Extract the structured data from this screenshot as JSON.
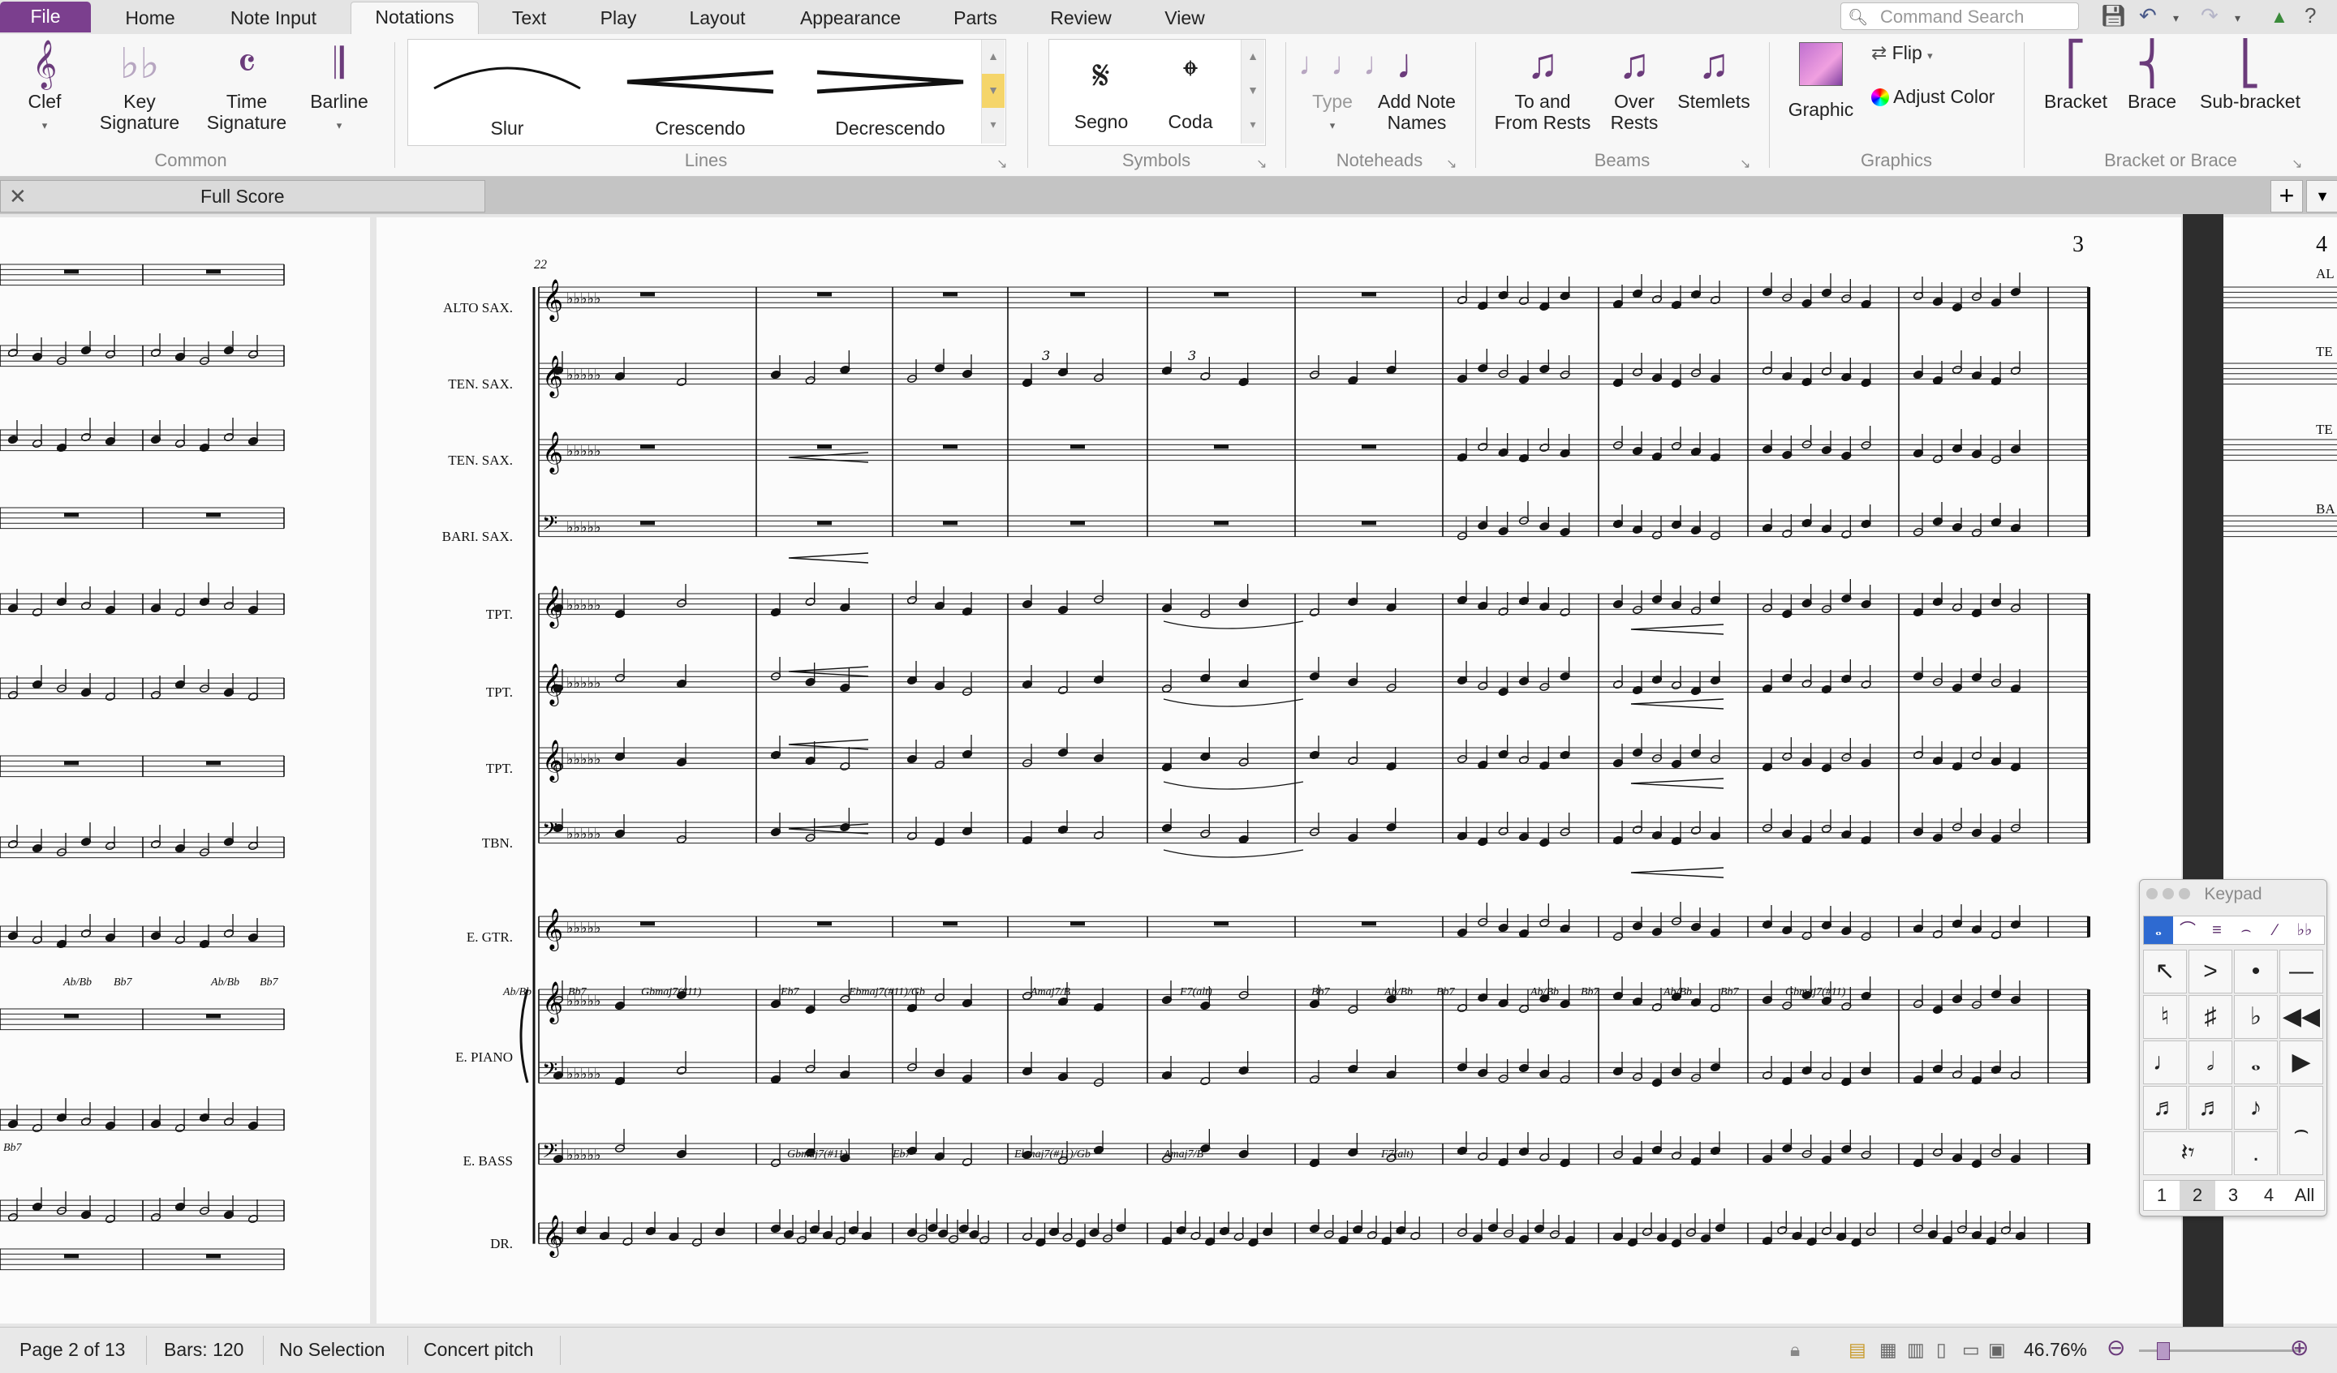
{
  "tabs": [
    {
      "label": "File"
    },
    {
      "label": "Home"
    },
    {
      "label": "Note Input"
    },
    {
      "label": "Notations"
    },
    {
      "label": "Text"
    },
    {
      "label": "Play"
    },
    {
      "label": "Layout"
    },
    {
      "label": "Appearance"
    },
    {
      "label": "Parts"
    },
    {
      "label": "Review"
    },
    {
      "label": "View"
    }
  ],
  "active_tab": "Notations",
  "command_search": {
    "placeholder": "Command Search"
  },
  "ribbon": {
    "common": {
      "label": "Common",
      "clef": "Clef",
      "key_signature": "Key\nSignature",
      "time_signature": "Time\nSignature",
      "barline": "Barline"
    },
    "lines": {
      "label": "Lines",
      "items": [
        "Slur",
        "Crescendo",
        "Decrescendo"
      ]
    },
    "symbols": {
      "label": "Symbols",
      "items": [
        "Segno",
        "Coda"
      ]
    },
    "noteheads": {
      "label": "Noteheads",
      "type": "Type",
      "add_note_names": "Add Note\nNames"
    },
    "beams": {
      "label": "Beams",
      "to_from_rests": "To and\nFrom Rests",
      "over_rests": "Over\nRests",
      "stemlets": "Stemlets"
    },
    "graphics": {
      "label": "Graphics",
      "graphic": "Graphic",
      "flip": "Flip",
      "adjust_color": "Adjust Color"
    },
    "bracket": {
      "label": "Bracket or Brace",
      "bracket": "Bracket",
      "brace": "Brace",
      "sub_bracket": "Sub-bracket"
    }
  },
  "document_tab": {
    "label": "Full Score"
  },
  "score": {
    "page_number": "3",
    "next_page_number": "4",
    "start_bar": "22",
    "instruments": [
      "ALTO SAX.",
      "TEN. SAX.",
      "TEN. SAX.",
      "BARI. SAX.",
      "TPT.",
      "TPT.",
      "TPT.",
      "TBN.",
      "E. GTR.",
      "E. PIANO",
      "E. BASS",
      "DR."
    ],
    "next_page_instruments": [
      "AL",
      "TE",
      "TE",
      "BA"
    ],
    "piano_chords": [
      "Ab/Bb",
      "Bb7",
      "Gbmaj7(#11)",
      "Eb7",
      "Ebmaj7(#11)/Gb",
      "Amaj7/B",
      "F7(alt)",
      "Bb7",
      "Ab/Bb",
      "Bb7",
      "Ab/Bb",
      "Bb7",
      "Ab/Bb",
      "Bb7",
      "Gbmaj7(#11)"
    ],
    "bass_chords": [
      "Gbmaj7(#11)",
      "Eb7",
      "Ebmaj7(#11)/Gb",
      "Amaj7/B",
      "F7(alt)"
    ],
    "left_chords": [
      "Ab/Bb",
      "Bb7",
      "Ab/Bb",
      "Bb7",
      "Bb7"
    ],
    "tuplet": "3"
  },
  "keypad": {
    "title": "Keypad",
    "tabs": [
      "1",
      "2",
      "3",
      "4",
      "All"
    ],
    "selected_tab": "2"
  },
  "status": {
    "page": "Page 2 of 13",
    "bars": "Bars: 120",
    "selection": "No Selection",
    "pitch": "Concert pitch",
    "zoom": "46.76%"
  },
  "colors": {
    "accent": "#7b3f8e",
    "icon": "#6b3b7b",
    "highlight": "#2e6ad1"
  }
}
